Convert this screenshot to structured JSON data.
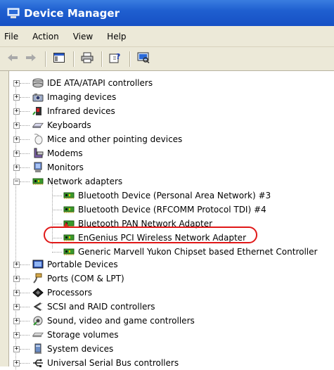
{
  "window": {
    "title": "Device Manager"
  },
  "menu": [
    {
      "label": "File"
    },
    {
      "label": "Action"
    },
    {
      "label": "View"
    },
    {
      "label": "Help"
    }
  ],
  "toolbar": [
    {
      "icon": "back-arrow-icon"
    },
    {
      "icon": "forward-arrow-icon"
    },
    {
      "icon": "show-hide-console-tree-icon"
    },
    {
      "icon": "print-icon"
    },
    {
      "icon": "properties-help-icon"
    },
    {
      "icon": "scan-hardware-icon"
    }
  ],
  "tree": {
    "categories_before": [
      {
        "label": "IDE ATA/ATAPI controllers",
        "icon": "ide-controller-icon",
        "expanded": false
      },
      {
        "label": "Imaging devices",
        "icon": "camera-icon",
        "expanded": false
      },
      {
        "label": "Infrared devices",
        "icon": "infrared-icon",
        "expanded": false
      },
      {
        "label": "Keyboards",
        "icon": "keyboard-icon",
        "expanded": false
      },
      {
        "label": "Mice and other pointing devices",
        "icon": "mouse-icon",
        "expanded": false
      },
      {
        "label": "Modems",
        "icon": "modem-icon",
        "expanded": false
      },
      {
        "label": "Monitors",
        "icon": "monitor-icon",
        "expanded": false
      }
    ],
    "network": {
      "label": "Network adapters",
      "icon": "network-adapter-icon",
      "expanded": true,
      "children": [
        {
          "label": "Bluetooth Device (Personal Area Network) #3",
          "icon": "network-adapter-icon"
        },
        {
          "label": "Bluetooth Device (RFCOMM Protocol TDI) #4",
          "icon": "network-adapter-icon"
        },
        {
          "label": "Bluetooth PAN Network Adapter",
          "icon": "network-adapter-icon"
        },
        {
          "label": "EnGenius PCI Wireless Network Adapter",
          "icon": "network-adapter-icon",
          "highlighted": true
        },
        {
          "label": "Generic Marvell Yukon Chipset based Ethernet Controller",
          "icon": "network-adapter-icon"
        }
      ]
    },
    "categories_after": [
      {
        "label": "Portable Devices",
        "icon": "portable-device-icon",
        "expanded": false
      },
      {
        "label": "Ports (COM & LPT)",
        "icon": "port-icon",
        "expanded": false
      },
      {
        "label": "Processors",
        "icon": "processor-icon",
        "expanded": false
      },
      {
        "label": "SCSI and RAID controllers",
        "icon": "scsi-icon",
        "expanded": false
      },
      {
        "label": "Sound, video and game controllers",
        "icon": "sound-icon",
        "expanded": false
      },
      {
        "label": "Storage volumes",
        "icon": "storage-icon",
        "expanded": false
      },
      {
        "label": "System devices",
        "icon": "system-icon",
        "expanded": false
      },
      {
        "label": "Universal Serial Bus controllers",
        "icon": "usb-icon",
        "expanded": false
      }
    ]
  },
  "colors": {
    "title_bar": "#1f5fd0",
    "chrome": "#ece9d8",
    "highlight_ring": "#e01818",
    "adapter_green": "#3a9a2a"
  }
}
